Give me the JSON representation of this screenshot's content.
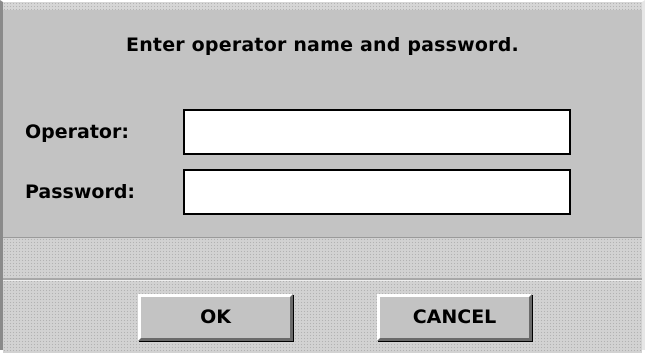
{
  "dialog": {
    "instruction": "Enter operator name and password.",
    "operator_label": "Operator:",
    "operator_value": "",
    "password_label": "Password:",
    "password_value": "",
    "ok_label": "OK",
    "cancel_label": "CANCEL"
  },
  "colors": {
    "dialog_background": "#c3c3c3",
    "field_background": "#ffffff",
    "text": "#000000"
  }
}
